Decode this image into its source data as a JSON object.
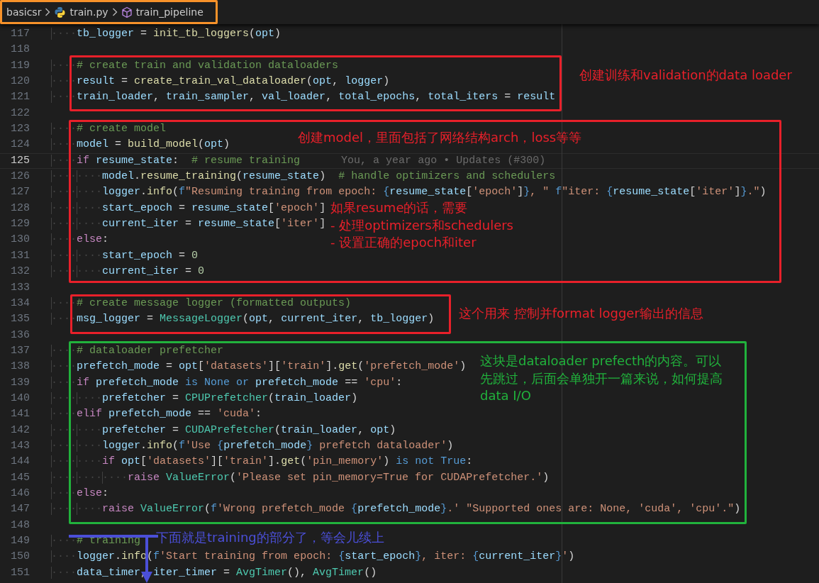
{
  "breadcrumb": [
    {
      "text": "basicsr",
      "kind": "folder"
    },
    {
      "text": "train.py",
      "kind": "file"
    },
    {
      "text": "train_pipeline",
      "kind": "symbol"
    }
  ],
  "lines": [
    {
      "number": "117",
      "current": false,
      "indent": "····",
      "tokens": [
        {
          "text": "tb_logger",
          "kind": "var"
        },
        {
          "text": " = ",
          "kind": "op"
        },
        {
          "text": "init_tb_loggers",
          "kind": "fn"
        },
        {
          "text": "(",
          "kind": "op"
        },
        {
          "text": "opt",
          "kind": "var"
        },
        {
          "text": ")",
          "kind": "op"
        }
      ]
    },
    {
      "number": "118",
      "current": false
    },
    {
      "number": "119",
      "current": false,
      "indent": "····",
      "tokens": [
        {
          "text": "# create train and validation dataloaders",
          "kind": "com"
        }
      ]
    },
    {
      "number": "120",
      "current": false,
      "indent": "····",
      "tokens": [
        {
          "text": "result",
          "kind": "var"
        },
        {
          "text": " = ",
          "kind": "op"
        },
        {
          "text": "create_train_val_dataloader",
          "kind": "fn"
        },
        {
          "text": "(",
          "kind": "op"
        },
        {
          "text": "opt",
          "kind": "var"
        },
        {
          "text": ", ",
          "kind": "op"
        },
        {
          "text": "logger",
          "kind": "var"
        },
        {
          "text": ")",
          "kind": "op"
        }
      ]
    },
    {
      "number": "121",
      "current": false,
      "indent": "····",
      "tokens": [
        {
          "text": "train_loader",
          "kind": "var"
        },
        {
          "text": ", ",
          "kind": "op"
        },
        {
          "text": "train_sampler",
          "kind": "var"
        },
        {
          "text": ", ",
          "kind": "op"
        },
        {
          "text": "val_loader",
          "kind": "var"
        },
        {
          "text": ", ",
          "kind": "op"
        },
        {
          "text": "total_epochs",
          "kind": "var"
        },
        {
          "text": ", ",
          "kind": "op"
        },
        {
          "text": "total_iters",
          "kind": "var"
        },
        {
          "text": " = ",
          "kind": "op"
        },
        {
          "text": "result",
          "kind": "var"
        }
      ]
    },
    {
      "number": "122",
      "current": false
    },
    {
      "number": "123",
      "current": false,
      "indent": "····",
      "tokens": [
        {
          "text": "# create model",
          "kind": "com"
        }
      ]
    },
    {
      "number": "124",
      "current": false,
      "indent": "····",
      "tokens": [
        {
          "text": "model",
          "kind": "var"
        },
        {
          "text": " = ",
          "kind": "op"
        },
        {
          "text": "build_model",
          "kind": "fn"
        },
        {
          "text": "(",
          "kind": "op"
        },
        {
          "text": "opt",
          "kind": "var"
        },
        {
          "text": ")",
          "kind": "op"
        }
      ]
    },
    {
      "number": "125",
      "current": true,
      "indent": "····",
      "tokens": [
        {
          "text": "if ",
          "kind": "kw"
        },
        {
          "text": "resume_state",
          "kind": "var"
        },
        {
          "text": ":  ",
          "kind": "op"
        },
        {
          "text": "# resume training",
          "kind": "com"
        },
        {
          "text": "You, a year ago • Updates (#300)",
          "kind": "blame"
        }
      ]
    },
    {
      "number": "126",
      "current": false,
      "indent": "········",
      "tokens": [
        {
          "text": "model",
          "kind": "var"
        },
        {
          "text": ".",
          "kind": "op"
        },
        {
          "text": "resume_training",
          "kind": "fn"
        },
        {
          "text": "(",
          "kind": "op"
        },
        {
          "text": "resume_state",
          "kind": "var"
        },
        {
          "text": ")  ",
          "kind": "op"
        },
        {
          "text": "# handle optimizers and schedulers",
          "kind": "com"
        }
      ]
    },
    {
      "number": "127",
      "current": false,
      "indent": "········",
      "tokens": [
        {
          "text": "logger",
          "kind": "var"
        },
        {
          "text": ".",
          "kind": "op"
        },
        {
          "text": "info",
          "kind": "fn"
        },
        {
          "text": "(",
          "kind": "op"
        },
        {
          "text": "f",
          "kind": "k2"
        },
        {
          "text": "\"Resuming training from epoch: ",
          "kind": "str"
        },
        {
          "text": "{",
          "kind": "k2"
        },
        {
          "text": "resume_state",
          "kind": "var"
        },
        {
          "text": "[",
          "kind": "op"
        },
        {
          "text": "'epoch'",
          "kind": "str"
        },
        {
          "text": "]",
          "kind": "op"
        },
        {
          "text": "}",
          "kind": "k2"
        },
        {
          "text": ", \" ",
          "kind": "str"
        },
        {
          "text": "f",
          "kind": "k2"
        },
        {
          "text": "\"iter: ",
          "kind": "str"
        },
        {
          "text": "{",
          "kind": "k2"
        },
        {
          "text": "resume_state",
          "kind": "var"
        },
        {
          "text": "[",
          "kind": "op"
        },
        {
          "text": "'iter'",
          "kind": "str"
        },
        {
          "text": "]",
          "kind": "op"
        },
        {
          "text": "}",
          "kind": "k2"
        },
        {
          "text": ".\"",
          "kind": "str"
        },
        {
          "text": ")",
          "kind": "op"
        }
      ]
    },
    {
      "number": "128",
      "current": false,
      "indent": "········",
      "tokens": [
        {
          "text": "start_epoch",
          "kind": "var"
        },
        {
          "text": " = ",
          "kind": "op"
        },
        {
          "text": "resume_state",
          "kind": "var"
        },
        {
          "text": "[",
          "kind": "op"
        },
        {
          "text": "'epoch'",
          "kind": "str"
        },
        {
          "text": "]",
          "kind": "op"
        }
      ]
    },
    {
      "number": "129",
      "current": false,
      "indent": "········",
      "tokens": [
        {
          "text": "current_iter",
          "kind": "var"
        },
        {
          "text": " = ",
          "kind": "op"
        },
        {
          "text": "resume_state",
          "kind": "var"
        },
        {
          "text": "[",
          "kind": "op"
        },
        {
          "text": "'iter'",
          "kind": "str"
        },
        {
          "text": "]",
          "kind": "op"
        }
      ]
    },
    {
      "number": "130",
      "current": false,
      "indent": "····",
      "tokens": [
        {
          "text": "else",
          "kind": "kw"
        },
        {
          "text": ":",
          "kind": "op"
        }
      ]
    },
    {
      "number": "131",
      "current": false,
      "indent": "········",
      "tokens": [
        {
          "text": "start_epoch",
          "kind": "var"
        },
        {
          "text": " = ",
          "kind": "op"
        },
        {
          "text": "0",
          "kind": "num"
        }
      ]
    },
    {
      "number": "132",
      "current": false,
      "indent": "········",
      "tokens": [
        {
          "text": "current_iter",
          "kind": "var"
        },
        {
          "text": " = ",
          "kind": "op"
        },
        {
          "text": "0",
          "kind": "num"
        }
      ]
    },
    {
      "number": "133",
      "current": false
    },
    {
      "number": "134",
      "current": false,
      "indent": "····",
      "tokens": [
        {
          "text": "# create message logger (formatted outputs)",
          "kind": "com"
        }
      ]
    },
    {
      "number": "135",
      "current": false,
      "indent": "····",
      "tokens": [
        {
          "text": "msg_logger",
          "kind": "var"
        },
        {
          "text": " = ",
          "kind": "op"
        },
        {
          "text": "MessageLogger",
          "kind": "cls"
        },
        {
          "text": "(",
          "kind": "op"
        },
        {
          "text": "opt",
          "kind": "var"
        },
        {
          "text": ", ",
          "kind": "op"
        },
        {
          "text": "current_iter",
          "kind": "var"
        },
        {
          "text": ", ",
          "kind": "op"
        },
        {
          "text": "tb_logger",
          "kind": "var"
        },
        {
          "text": ")",
          "kind": "op"
        }
      ]
    },
    {
      "number": "136",
      "current": false
    },
    {
      "number": "137",
      "current": false,
      "indent": "····",
      "tokens": [
        {
          "text": "# dataloader prefetcher",
          "kind": "com"
        }
      ]
    },
    {
      "number": "138",
      "current": false,
      "indent": "····",
      "tokens": [
        {
          "text": "prefetch_mode",
          "kind": "var"
        },
        {
          "text": " = ",
          "kind": "op"
        },
        {
          "text": "opt",
          "kind": "var"
        },
        {
          "text": "[",
          "kind": "op"
        },
        {
          "text": "'datasets'",
          "kind": "str"
        },
        {
          "text": "][",
          "kind": "op"
        },
        {
          "text": "'train'",
          "kind": "str"
        },
        {
          "text": "].",
          "kind": "op"
        },
        {
          "text": "get",
          "kind": "fn"
        },
        {
          "text": "(",
          "kind": "op"
        },
        {
          "text": "'prefetch_mode'",
          "kind": "str"
        },
        {
          "text": ")",
          "kind": "op"
        }
      ]
    },
    {
      "number": "139",
      "current": false,
      "indent": "····",
      "tokens": [
        {
          "text": "if ",
          "kind": "kw"
        },
        {
          "text": "prefetch_mode",
          "kind": "var"
        },
        {
          "text": " is None or ",
          "kind": "k2"
        },
        {
          "text": "prefetch_mode",
          "kind": "var"
        },
        {
          "text": " == ",
          "kind": "op"
        },
        {
          "text": "'cpu'",
          "kind": "str"
        },
        {
          "text": ":",
          "kind": "op"
        }
      ]
    },
    {
      "number": "140",
      "current": false,
      "indent": "········",
      "tokens": [
        {
          "text": "prefetcher",
          "kind": "var"
        },
        {
          "text": " = ",
          "kind": "op"
        },
        {
          "text": "CPUPrefetcher",
          "kind": "cls"
        },
        {
          "text": "(",
          "kind": "op"
        },
        {
          "text": "train_loader",
          "kind": "var"
        },
        {
          "text": ")",
          "kind": "op"
        }
      ]
    },
    {
      "number": "141",
      "current": false,
      "indent": "····",
      "tokens": [
        {
          "text": "elif ",
          "kind": "kw"
        },
        {
          "text": "prefetch_mode",
          "kind": "var"
        },
        {
          "text": " == ",
          "kind": "op"
        },
        {
          "text": "'cuda'",
          "kind": "str"
        },
        {
          "text": ":",
          "kind": "op"
        }
      ]
    },
    {
      "number": "142",
      "current": false,
      "indent": "········",
      "tokens": [
        {
          "text": "prefetcher",
          "kind": "var"
        },
        {
          "text": " = ",
          "kind": "op"
        },
        {
          "text": "CUDAPrefetcher",
          "kind": "cls"
        },
        {
          "text": "(",
          "kind": "op"
        },
        {
          "text": "train_loader",
          "kind": "var"
        },
        {
          "text": ", ",
          "kind": "op"
        },
        {
          "text": "opt",
          "kind": "var"
        },
        {
          "text": ")",
          "kind": "op"
        }
      ]
    },
    {
      "number": "143",
      "current": false,
      "indent": "········",
      "tokens": [
        {
          "text": "logger",
          "kind": "var"
        },
        {
          "text": ".",
          "kind": "op"
        },
        {
          "text": "info",
          "kind": "fn"
        },
        {
          "text": "(",
          "kind": "op"
        },
        {
          "text": "f",
          "kind": "k2"
        },
        {
          "text": "'Use ",
          "kind": "str"
        },
        {
          "text": "{",
          "kind": "k2"
        },
        {
          "text": "prefetch_mode",
          "kind": "var"
        },
        {
          "text": "}",
          "kind": "k2"
        },
        {
          "text": " prefetch dataloader'",
          "kind": "str"
        },
        {
          "text": ")",
          "kind": "op"
        }
      ]
    },
    {
      "number": "144",
      "current": false,
      "indent": "········",
      "tokens": [
        {
          "text": "if ",
          "kind": "kw"
        },
        {
          "text": "opt",
          "kind": "var"
        },
        {
          "text": "[",
          "kind": "op"
        },
        {
          "text": "'datasets'",
          "kind": "str"
        },
        {
          "text": "][",
          "kind": "op"
        },
        {
          "text": "'train'",
          "kind": "str"
        },
        {
          "text": "].",
          "kind": "op"
        },
        {
          "text": "get",
          "kind": "fn"
        },
        {
          "text": "(",
          "kind": "op"
        },
        {
          "text": "'pin_memory'",
          "kind": "str"
        },
        {
          "text": ")",
          "kind": "op"
        },
        {
          "text": " is not True",
          "kind": "k2"
        },
        {
          "text": ":",
          "kind": "op"
        }
      ]
    },
    {
      "number": "145",
      "current": false,
      "indent": "············",
      "tokens": [
        {
          "text": "raise ",
          "kind": "kw"
        },
        {
          "text": "ValueError",
          "kind": "cls"
        },
        {
          "text": "(",
          "kind": "op"
        },
        {
          "text": "'Please set pin_memory=True for CUDAPrefetcher.'",
          "kind": "str"
        },
        {
          "text": ")",
          "kind": "op"
        }
      ]
    },
    {
      "number": "146",
      "current": false,
      "indent": "····",
      "tokens": [
        {
          "text": "else",
          "kind": "kw"
        },
        {
          "text": ":",
          "kind": "op"
        }
      ]
    },
    {
      "number": "147",
      "current": false,
      "indent": "········",
      "tokens": [
        {
          "text": "raise ",
          "kind": "kw"
        },
        {
          "text": "ValueError",
          "kind": "cls"
        },
        {
          "text": "(",
          "kind": "op"
        },
        {
          "text": "f",
          "kind": "k2"
        },
        {
          "text": "'Wrong prefetch_mode ",
          "kind": "str"
        },
        {
          "text": "{",
          "kind": "k2"
        },
        {
          "text": "prefetch_mode",
          "kind": "var"
        },
        {
          "text": "}",
          "kind": "k2"
        },
        {
          "text": ".' \"Supported ones are: None, 'cuda', 'cpu'.\"",
          "kind": "str"
        },
        {
          "text": ")",
          "kind": "op"
        }
      ]
    },
    {
      "number": "148",
      "current": false
    },
    {
      "number": "149",
      "current": false,
      "indent": "····",
      "tokens": [
        {
          "text": "# training",
          "kind": "com"
        }
      ]
    },
    {
      "number": "150",
      "current": false,
      "indent": "····",
      "tokens": [
        {
          "text": "logger",
          "kind": "var"
        },
        {
          "text": ".",
          "kind": "op"
        },
        {
          "text": "info",
          "kind": "fn"
        },
        {
          "text": "(",
          "kind": "op"
        },
        {
          "text": "f",
          "kind": "k2"
        },
        {
          "text": "'Start training from epoch: ",
          "kind": "str"
        },
        {
          "text": "{",
          "kind": "k2"
        },
        {
          "text": "start_epoch",
          "kind": "var"
        },
        {
          "text": "}",
          "kind": "k2"
        },
        {
          "text": ", iter: ",
          "kind": "str"
        },
        {
          "text": "{",
          "kind": "k2"
        },
        {
          "text": "current_iter",
          "kind": "var"
        },
        {
          "text": "}",
          "kind": "k2"
        },
        {
          "text": "'",
          "kind": "str"
        },
        {
          "text": ")",
          "kind": "op"
        }
      ]
    },
    {
      "number": "151",
      "current": false,
      "indent": "····",
      "tokens": [
        {
          "text": "data_timer",
          "kind": "var"
        },
        {
          "text": ", ",
          "kind": "op"
        },
        {
          "text": "iter_timer",
          "kind": "var"
        },
        {
          "text": " = ",
          "kind": "op"
        },
        {
          "text": "AvgTimer",
          "kind": "cls"
        },
        {
          "text": "(), ",
          "kind": "op"
        },
        {
          "text": "AvgTimer",
          "kind": "cls"
        },
        {
          "text": "()",
          "kind": "op"
        }
      ]
    }
  ],
  "annotations": [
    {
      "kind": "box",
      "color": "#f7922a"
    },
    {
      "kind": "box",
      "color": "#e8202a"
    },
    {
      "kind": "box",
      "color": "#e8202a"
    },
    {
      "kind": "box",
      "color": "#e8202a"
    },
    {
      "kind": "box",
      "color": "#21b23c"
    },
    {
      "kind": "note",
      "color": "#e8202a",
      "lines": [
        "创建训练和validation的data loader"
      ]
    },
    {
      "kind": "note",
      "color": "#e8202a",
      "lines": [
        "创建model，里面包括了网络结构arch，loss等等"
      ]
    },
    {
      "kind": "note",
      "color": "#e8202a",
      "lines": [
        "如果resume的话，需要",
        "- 处理optimizers和schedulers",
        "- 设置正确的epoch和iter"
      ]
    },
    {
      "kind": "note",
      "color": "#e8202a",
      "lines": [
        "这个用来 控制并format logger输出的信息"
      ]
    },
    {
      "kind": "note",
      "color": "#21b23c",
      "lines": [
        "这块是dataloader prefecth的内容。可以",
        "先跳过，后面会单独开一篇来说，如何提高",
        "data I/O"
      ]
    },
    {
      "kind": "note",
      "color": "#4b4fd8",
      "lines": [
        "下面就是training的部分了，等会儿续上"
      ]
    },
    {
      "kind": "arrow",
      "color": "#4b4fd8"
    }
  ]
}
